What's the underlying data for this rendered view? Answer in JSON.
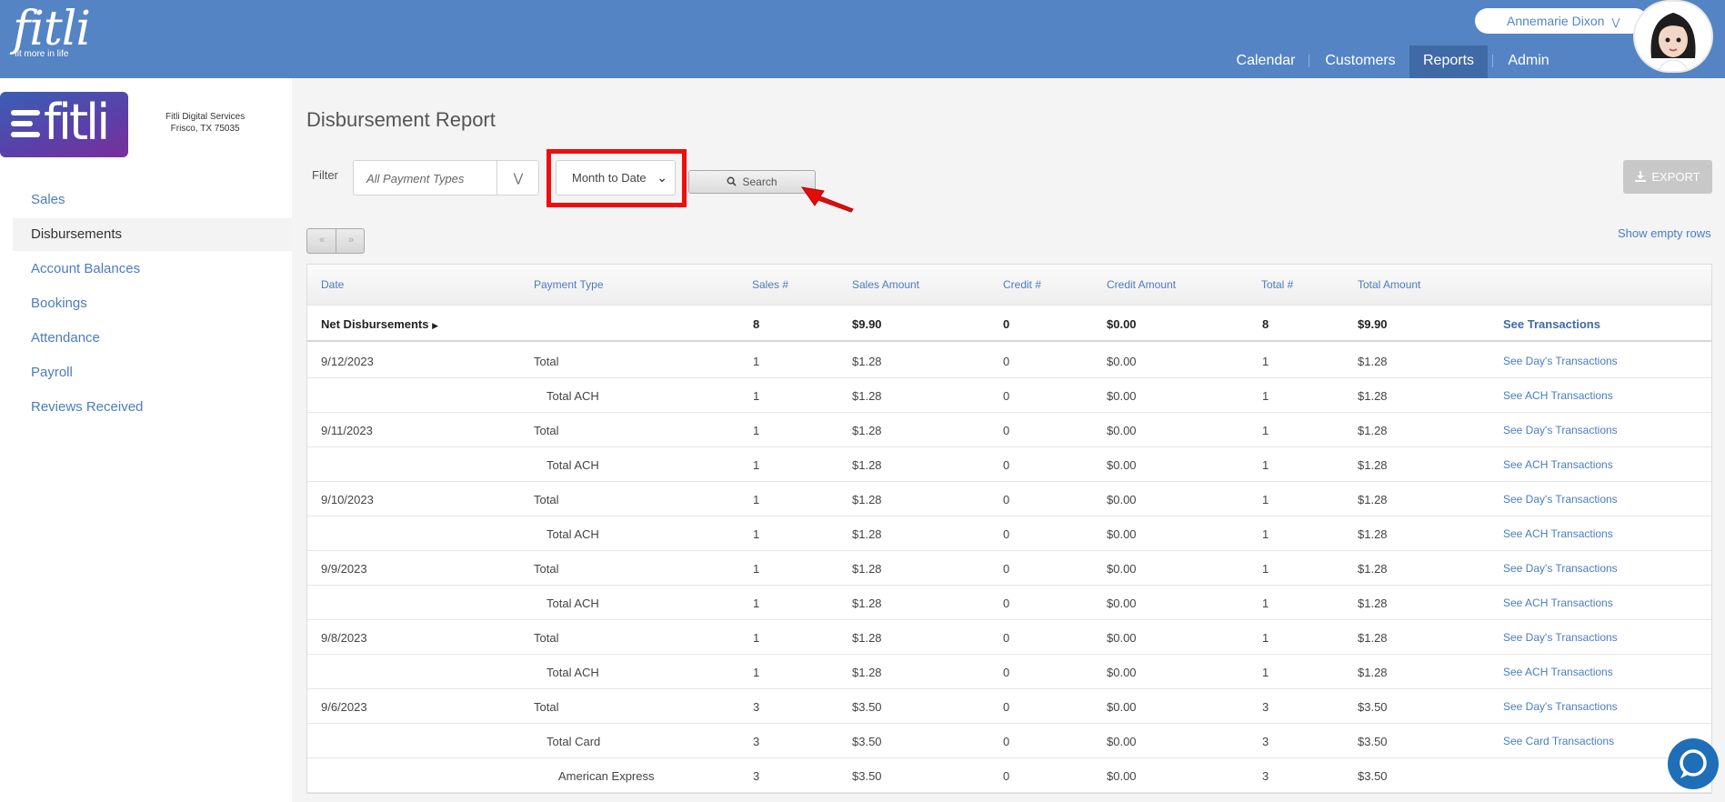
{
  "header": {
    "logo_wordmark": "fitli",
    "logo_tagline": "fit more in life",
    "user_name": "Annemarie Dixon",
    "nav": [
      {
        "label": "Calendar",
        "active": false
      },
      {
        "label": "Customers",
        "active": false
      },
      {
        "label": "Reports",
        "active": true
      },
      {
        "label": "Admin",
        "active": false
      }
    ]
  },
  "sidebar": {
    "brand_wordmark": "fitli",
    "company_name": "Fitli Digital Services",
    "company_location": "Frisco, TX 75035",
    "items": [
      {
        "label": "Sales",
        "active": false
      },
      {
        "label": "Disbursements",
        "active": true
      },
      {
        "label": "Account Balances",
        "active": false
      },
      {
        "label": "Bookings",
        "active": false
      },
      {
        "label": "Attendance",
        "active": false
      },
      {
        "label": "Payroll",
        "active": false
      },
      {
        "label": "Reviews Received",
        "active": false
      }
    ]
  },
  "report": {
    "title": "Disbursement Report",
    "filter_label": "Filter",
    "payment_type_placeholder": "All Payment Types",
    "date_range_value": "Month to Date",
    "search_label": "Search",
    "export_label": "EXPORT",
    "show_empty_rows": "Show empty rows"
  },
  "table": {
    "columns": [
      "Date",
      "Payment Type",
      "Sales #",
      "Sales Amount",
      "Credit #",
      "Credit Amount",
      "Total #",
      "Total Amount"
    ],
    "net": {
      "label": "Net Disbursements",
      "sales_count": "8",
      "sales_amount": "$9.90",
      "credit_count": "0",
      "credit_amount": "$0.00",
      "total_count": "8",
      "total_amount": "$9.90",
      "link": "See Transactions"
    },
    "rows": [
      {
        "date": "9/12/2023",
        "type": "Total",
        "indent": 0,
        "sales_count": "1",
        "sales_amount": "$1.28",
        "credit_count": "0",
        "credit_amount": "$0.00",
        "total_count": "1",
        "total_amount": "$1.28",
        "link": "See Day's Transactions"
      },
      {
        "date": "",
        "type": "Total ACH",
        "indent": 1,
        "sales_count": "1",
        "sales_amount": "$1.28",
        "credit_count": "0",
        "credit_amount": "$0.00",
        "total_count": "1",
        "total_amount": "$1.28",
        "link": "See ACH Transactions"
      },
      {
        "date": "9/11/2023",
        "type": "Total",
        "indent": 0,
        "sales_count": "1",
        "sales_amount": "$1.28",
        "credit_count": "0",
        "credit_amount": "$0.00",
        "total_count": "1",
        "total_amount": "$1.28",
        "link": "See Day's Transactions"
      },
      {
        "date": "",
        "type": "Total ACH",
        "indent": 1,
        "sales_count": "1",
        "sales_amount": "$1.28",
        "credit_count": "0",
        "credit_amount": "$0.00",
        "total_count": "1",
        "total_amount": "$1.28",
        "link": "See ACH Transactions"
      },
      {
        "date": "9/10/2023",
        "type": "Total",
        "indent": 0,
        "sales_count": "1",
        "sales_amount": "$1.28",
        "credit_count": "0",
        "credit_amount": "$0.00",
        "total_count": "1",
        "total_amount": "$1.28",
        "link": "See Day's Transactions"
      },
      {
        "date": "",
        "type": "Total ACH",
        "indent": 1,
        "sales_count": "1",
        "sales_amount": "$1.28",
        "credit_count": "0",
        "credit_amount": "$0.00",
        "total_count": "1",
        "total_amount": "$1.28",
        "link": "See ACH Transactions"
      },
      {
        "date": "9/9/2023",
        "type": "Total",
        "indent": 0,
        "sales_count": "1",
        "sales_amount": "$1.28",
        "credit_count": "0",
        "credit_amount": "$0.00",
        "total_count": "1",
        "total_amount": "$1.28",
        "link": "See Day's Transactions"
      },
      {
        "date": "",
        "type": "Total ACH",
        "indent": 1,
        "sales_count": "1",
        "sales_amount": "$1.28",
        "credit_count": "0",
        "credit_amount": "$0.00",
        "total_count": "1",
        "total_amount": "$1.28",
        "link": "See ACH Transactions"
      },
      {
        "date": "9/8/2023",
        "type": "Total",
        "indent": 0,
        "sales_count": "1",
        "sales_amount": "$1.28",
        "credit_count": "0",
        "credit_amount": "$0.00",
        "total_count": "1",
        "total_amount": "$1.28",
        "link": "See Day's Transactions"
      },
      {
        "date": "",
        "type": "Total ACH",
        "indent": 1,
        "sales_count": "1",
        "sales_amount": "$1.28",
        "credit_count": "0",
        "credit_amount": "$0.00",
        "total_count": "1",
        "total_amount": "$1.28",
        "link": "See ACH Transactions"
      },
      {
        "date": "9/6/2023",
        "type": "Total",
        "indent": 0,
        "sales_count": "3",
        "sales_amount": "$3.50",
        "credit_count": "0",
        "credit_amount": "$0.00",
        "total_count": "3",
        "total_amount": "$3.50",
        "link": "See Day's Transactions"
      },
      {
        "date": "",
        "type": "Total Card",
        "indent": 1,
        "sales_count": "3",
        "sales_amount": "$3.50",
        "credit_count": "0",
        "credit_amount": "$0.00",
        "total_count": "3",
        "total_amount": "$3.50",
        "link": "See Card Transactions"
      },
      {
        "date": "",
        "type": "American Express",
        "indent": 2,
        "sales_count": "3",
        "sales_amount": "$3.50",
        "credit_count": "0",
        "credit_amount": "$0.00",
        "total_count": "3",
        "total_amount": "$3.50",
        "link": ""
      }
    ]
  },
  "icons": {
    "search": "search-icon",
    "export": "download-icon",
    "payment_dropdown": "double-chevron-down-icon",
    "chat": "chat-bubble-icon"
  },
  "colors": {
    "header_bg": "#5584c4",
    "nav_active": "#3f6aa6",
    "link": "#4a7cc2",
    "highlight": "#f10d0d"
  }
}
